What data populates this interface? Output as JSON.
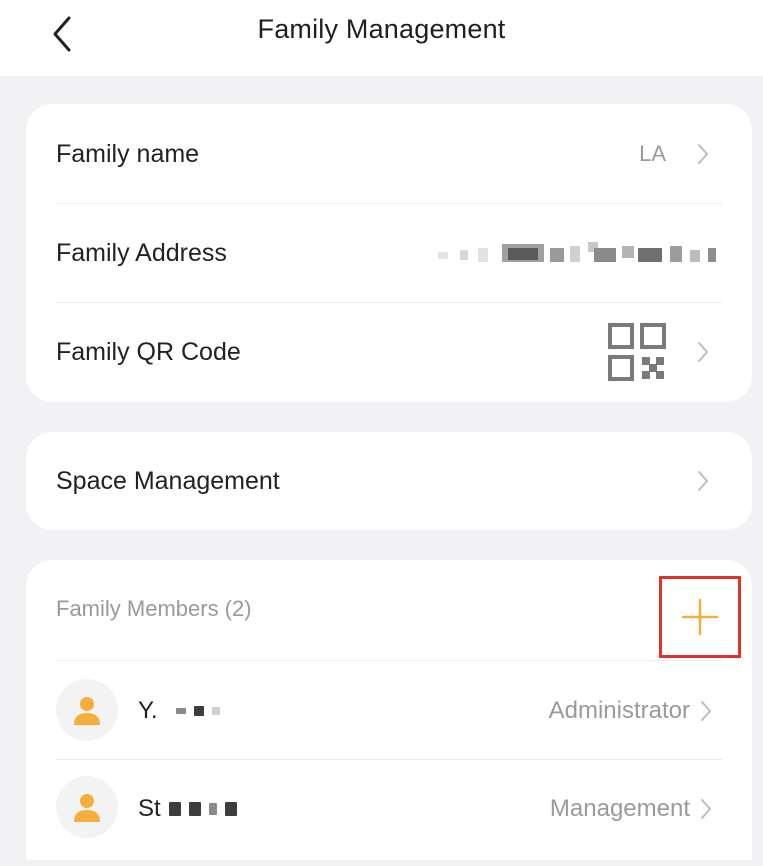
{
  "header": {
    "title": "Family Management",
    "back_icon": "chevron-left-icon"
  },
  "family_info": {
    "name_label": "Family name",
    "name_value": "LA",
    "address_label": "Family Address",
    "address_value_redacted": true,
    "qr_label": "Family QR Code",
    "qr_icon": "qr-code-icon"
  },
  "space": {
    "label": "Space Management"
  },
  "members": {
    "title": "Family Members (2)",
    "add_icon": "plus-icon",
    "list": [
      {
        "name": "Y.",
        "role": "Administrator",
        "avatar_icon": "user-avatar-icon"
      },
      {
        "name": "St",
        "role": "Management",
        "avatar_icon": "user-avatar-icon"
      }
    ]
  },
  "colors": {
    "accent": "#f3ae3c",
    "highlight_box": "#e0322b",
    "page_background": "#f2f2f4",
    "secondary_text": "#9a9a9a"
  }
}
